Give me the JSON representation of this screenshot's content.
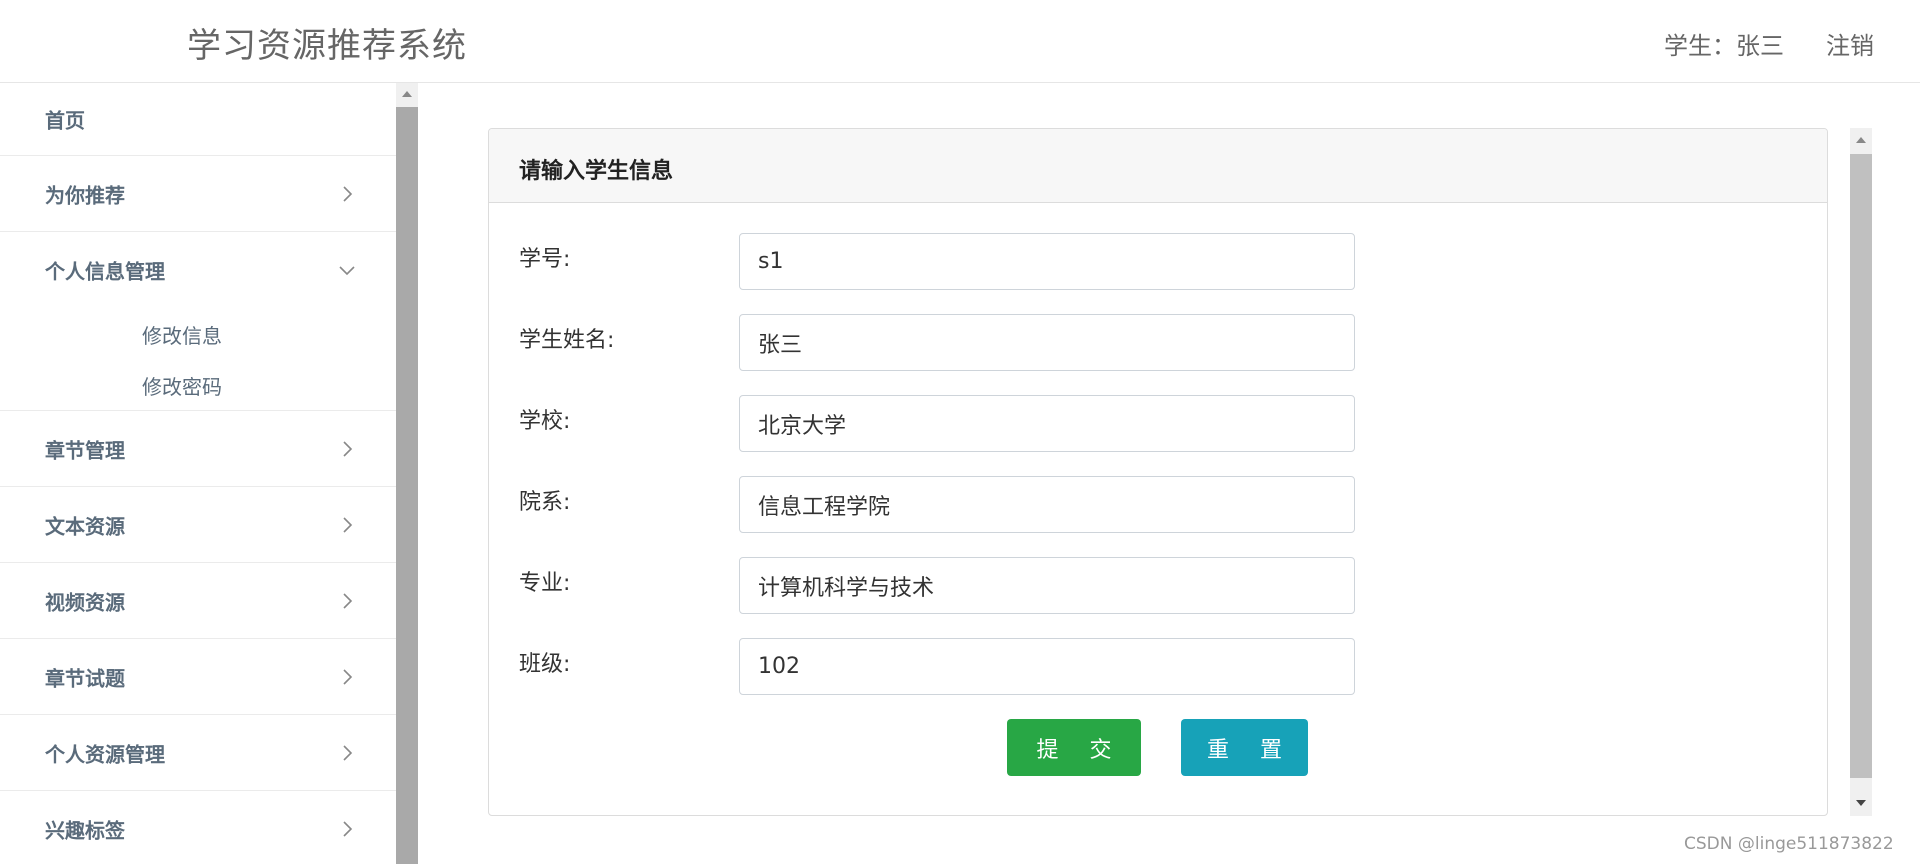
{
  "header": {
    "app_title": "学习资源推荐系统",
    "user_label": "学生：张三",
    "logout_label": "注销"
  },
  "sidebar": {
    "items": [
      {
        "label": "首页"
      },
      {
        "label": "为你推荐"
      },
      {
        "label": "个人信息管理",
        "expanded": true,
        "children": [
          {
            "label": "修改信息"
          },
          {
            "label": "修改密码"
          }
        ]
      },
      {
        "label": "章节管理"
      },
      {
        "label": "文本资源"
      },
      {
        "label": "视频资源"
      },
      {
        "label": "章节试题"
      },
      {
        "label": "个人资源管理"
      },
      {
        "label": "兴趣标签"
      }
    ]
  },
  "form": {
    "title": "请输入学生信息",
    "fields": [
      {
        "label": "学号:",
        "value": "s1"
      },
      {
        "label": "学生姓名:",
        "value": "张三"
      },
      {
        "label": "学校:",
        "value": "北京大学"
      },
      {
        "label": "院系:",
        "value": "信息工程学院"
      },
      {
        "label": "专业:",
        "value": "计算机科学与技术"
      },
      {
        "label": "班级:",
        "value": "102"
      }
    ],
    "submit_label": "提 交",
    "reset_label": "重 置"
  },
  "colors": {
    "submit": "#28a745",
    "reset": "#17a2b8",
    "nav_text": "#5a6b7b"
  },
  "icons": {
    "collapsed": "chevron-right-icon",
    "expanded": "chevron-down-icon"
  },
  "watermark": "CSDN @linge511873822"
}
